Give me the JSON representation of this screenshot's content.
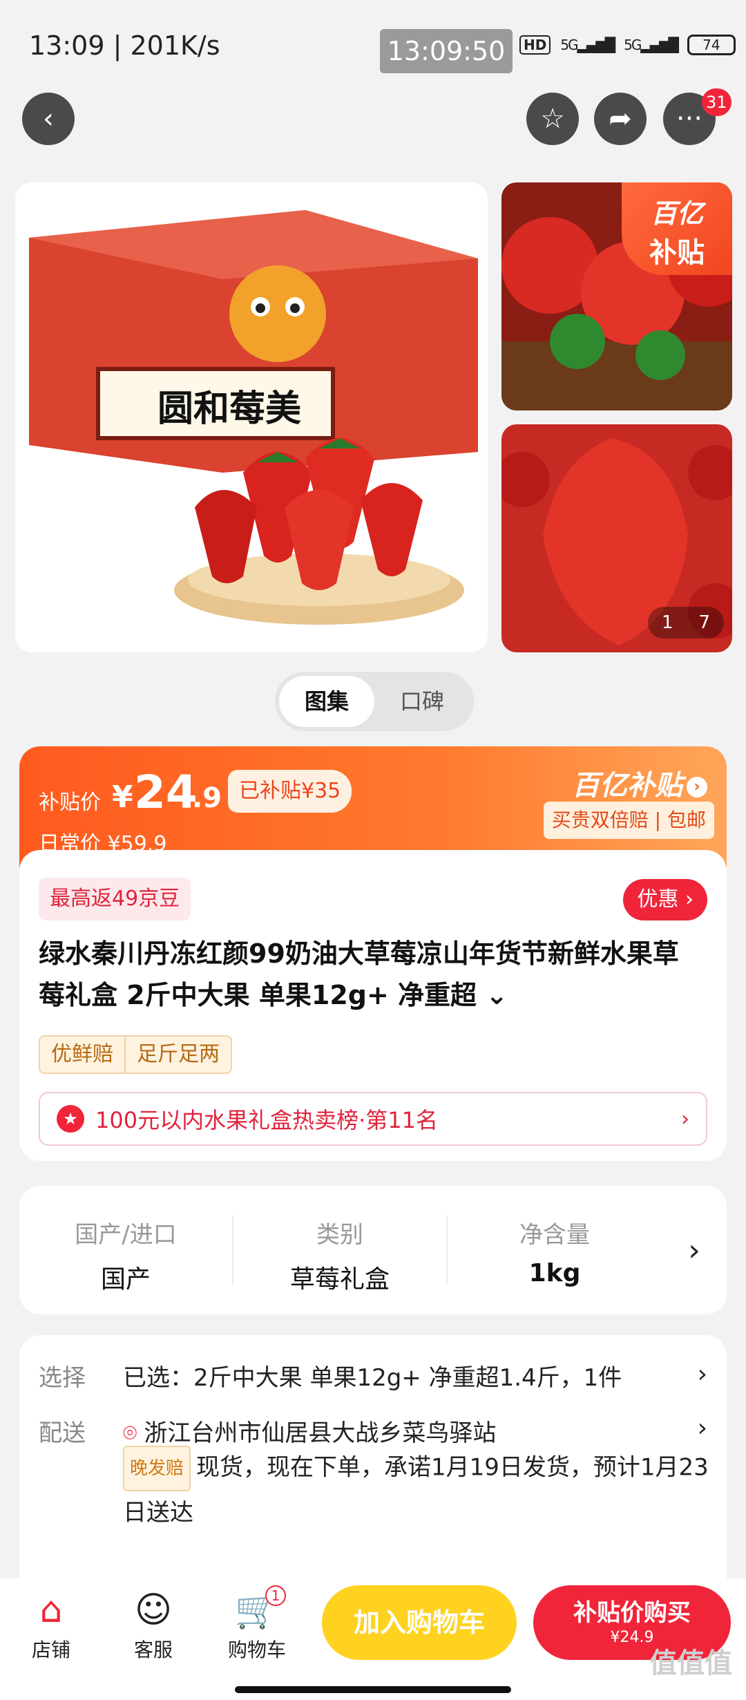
{
  "status": {
    "time_speed": "13:09 | 201K/s",
    "clock": "13:09:50",
    "hd": "HD",
    "net1": "5G",
    "net2": "5G",
    "battery": "74"
  },
  "nav": {
    "more_badge": "31"
  },
  "gallery": {
    "main_box_text": "圆和莓美",
    "side_badge_line1": "百亿",
    "side_badge_line2": "补贴",
    "pager_current": "1",
    "pager_total": "7"
  },
  "tabs": [
    "图集",
    "口碑"
  ],
  "price": {
    "subsidy_label": "补贴价",
    "currency": "¥",
    "price_int": "24",
    "price_dec": ".9",
    "subsidized": "已补贴¥35",
    "daily_price": "日常价 ¥59.9",
    "brand": "百亿补贴",
    "brand_tags": "买贵双倍赔 | 包邮"
  },
  "product": {
    "jd_beans": "最高返49京豆",
    "youhui": "优惠",
    "title": "绿水秦川丹冻红颜99奶油大草莓凉山年货节新鲜水果草莓礼盒 2斤中大果 单果12g+ 净重超",
    "title_more": "⌄",
    "guarantees": [
      "优鲜赔",
      "足斤足两"
    ],
    "rank": "100元以内水果礼盒热卖榜·第11名"
  },
  "specs": [
    {
      "key": "国产/进口",
      "value": "国产"
    },
    {
      "key": "类别",
      "value": "草莓礼盒"
    },
    {
      "key": "净含量",
      "value": "1kg"
    }
  ],
  "options": {
    "select_label": "选择",
    "select_value": "已选：2斤中大果 单果12g+ 净重超1.4斤，1件",
    "delivery_label": "配送",
    "address": "浙江台州市仙居县大战乡菜鸟驿站",
    "late_tag": "晚发赔",
    "shipping": "现货，现在下单，承诺1月19日发货，预计1月23日送达"
  },
  "bottom": {
    "store": "店铺",
    "service": "客服",
    "cart": "购物车",
    "cart_count": "1",
    "add_cart": "加入购物车",
    "buy_now": "补贴价购买",
    "buy_price": "¥24.9"
  },
  "watermark": "值值值",
  "colors": {
    "accent_red": "#f0253a",
    "accent_orange": "#ff5a1e",
    "accent_yellow": "#ffd21f"
  }
}
